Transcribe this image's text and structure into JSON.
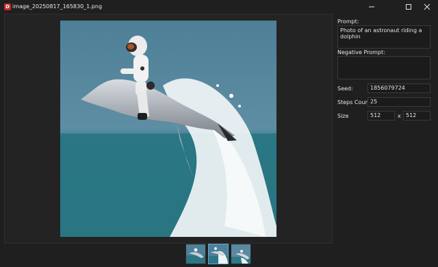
{
  "window": {
    "title": "image_20250817_165830_1.png",
    "app_icon_letter": "D"
  },
  "panel": {
    "prompt_label": "Prompt:",
    "prompt_value": "Photo of an astronaut riding a dolphin",
    "negative_prompt_label": "Negative Prompt:",
    "negative_prompt_value": "",
    "seed_label": "Seed:",
    "seed_value": "1856079724",
    "steps_label": "Steps Count",
    "steps_value": "25",
    "size_label": "Size",
    "size_width": "512",
    "size_separator": "x",
    "size_height": "512"
  },
  "thumbnails": {
    "count": 3,
    "selected_index": 1
  },
  "icons": {
    "minimize": "minimize-icon",
    "maximize": "maximize-icon",
    "close": "close-icon",
    "app": "app-icon"
  },
  "colors": {
    "accent": "#67a5dd",
    "background": "#1f1f1f"
  }
}
